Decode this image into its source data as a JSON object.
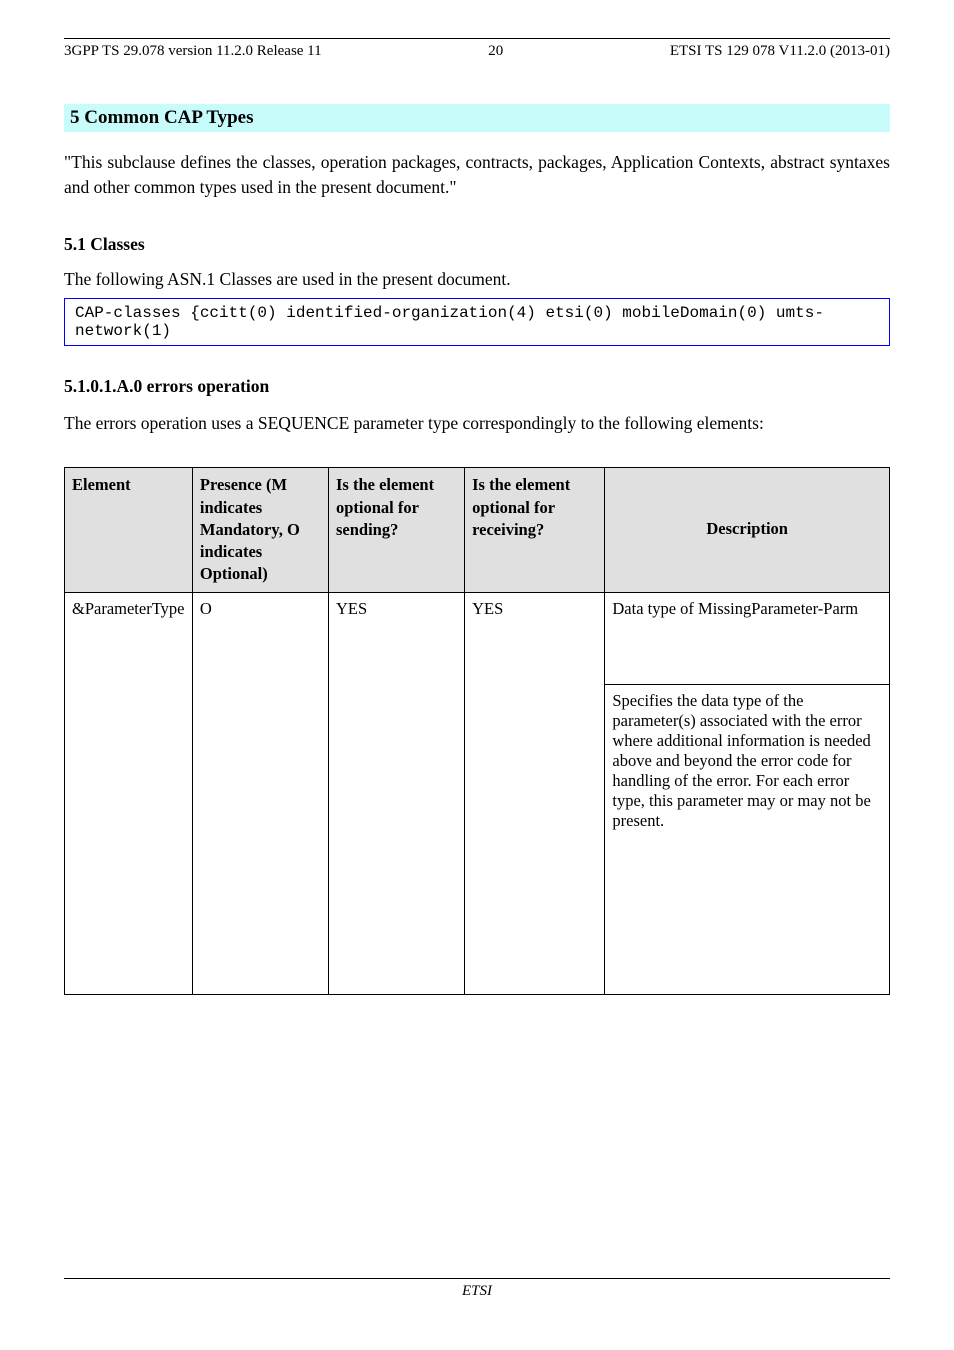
{
  "header": {
    "left": "3GPP TS 29.078 version 11.2.0 Release 11",
    "page": "20",
    "right": "ETSI TS 129 078 V11.2.0 (2013-01)"
  },
  "section_title": "5 Common CAP Types",
  "body_intro": "\"This subclause defines the classes, operation packages, contracts, packages, Application Contexts, abstract syntaxes and other common types used in the present document.\"",
  "h2_classes": "5.1 Classes",
  "classes_body": "The following ASN.1 Classes are used in the present document.",
  "code_box": "CAP-classes {ccitt(0) identified-organization(4) etsi(0) mobileDomain(0) umts-network(1)",
  "h3_errors": "5.1.0.1.A.0 errors operation",
  "h3_errors_body": "The errors operation uses a SEQUENCE parameter type correspondingly to the following elements:",
  "table": {
    "headers": [
      "Element",
      "Presence (M indicates Mandatory, O indicates Optional)",
      "Is the element optional for sending?",
      "Is the element optional for receiving?",
      "Description"
    ],
    "rows": [
      {
        "element": "&ParameterType",
        "presence": "O",
        "send_optional": "YES",
        "recv_optional": "YES",
        "desc1": "Data type of MissingParameter-Parm",
        "desc2": "Specifies the data type of the parameter(s) associated with the error where additional information is needed above and beyond the error code for handling of the error. For each error type, this parameter may or may not be present."
      }
    ]
  },
  "footer": {
    "org": "ETSI"
  }
}
